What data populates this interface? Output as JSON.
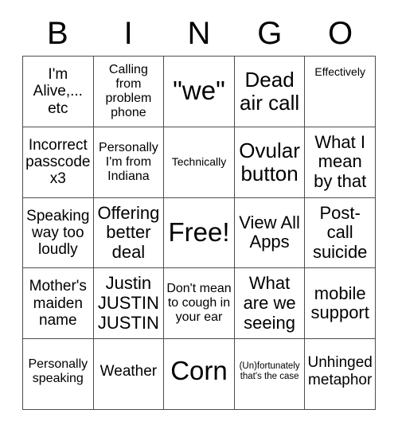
{
  "title": "BINGO",
  "header": {
    "letters": [
      "B",
      "I",
      "N",
      "G",
      "O"
    ]
  },
  "colors": {
    "background": "#ffffff",
    "text": "#000000",
    "grid_line": "#4d4d4d"
  },
  "grid": {
    "columns": 5,
    "rows": 5,
    "free_space_index": 12,
    "cells": [
      {
        "text": "I'm Alive,... etc",
        "size": "md",
        "align": "center"
      },
      {
        "text": "Calling from problem phone",
        "size": "sm",
        "align": "center"
      },
      {
        "text": "\"we\"",
        "size": "xxl",
        "align": "center"
      },
      {
        "text": "Dead air call",
        "size": "xl",
        "align": "center"
      },
      {
        "text": "Effectively",
        "size": "xs",
        "align": "top"
      },
      {
        "text": "Incorrect passcode x3",
        "size": "md",
        "align": "center"
      },
      {
        "text": "Personally I'm from Indiana",
        "size": "sm",
        "align": "center"
      },
      {
        "text": "Technically",
        "size": "xs",
        "align": "center"
      },
      {
        "text": "Ovular button",
        "size": "xl",
        "align": "center"
      },
      {
        "text": "What I mean by that",
        "size": "lg",
        "align": "center"
      },
      {
        "text": "Speaking way too loudly",
        "size": "md",
        "align": "center"
      },
      {
        "text": "Offering better deal",
        "size": "lg",
        "align": "center"
      },
      {
        "text": "Free!",
        "size": "xxl",
        "align": "center"
      },
      {
        "text": "View All Apps",
        "size": "lg",
        "align": "center"
      },
      {
        "text": "Post-call suicide",
        "size": "lg",
        "align": "center"
      },
      {
        "text": "Mother's maiden name",
        "size": "md",
        "align": "center"
      },
      {
        "text": "Justin JUSTIN JUSTIN",
        "size": "lg",
        "align": "center"
      },
      {
        "text": "Don't mean to cough in your ear",
        "size": "sm",
        "align": "center"
      },
      {
        "text": "What are we seeing",
        "size": "lg",
        "align": "center"
      },
      {
        "text": "mobile support",
        "size": "lg",
        "align": "center"
      },
      {
        "text": "Personally speaking",
        "size": "sm",
        "align": "upper"
      },
      {
        "text": "Weather",
        "size": "md",
        "align": "upper"
      },
      {
        "text": "Corn",
        "size": "xxl",
        "align": "upper"
      },
      {
        "text": "(Un)fortunately that's the case",
        "size": "xxs",
        "align": "upper"
      },
      {
        "text": "Unhinged metaphor",
        "size": "md",
        "align": "upper"
      }
    ]
  }
}
